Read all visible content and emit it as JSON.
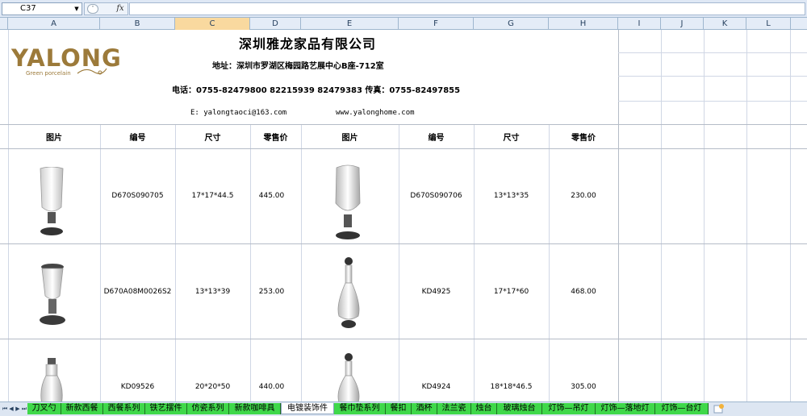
{
  "formula_bar": {
    "cell_ref": "C37",
    "fx_label": "fx"
  },
  "columns": [
    "A",
    "B",
    "C",
    "D",
    "E",
    "F",
    "G",
    "H",
    "I",
    "J",
    "K",
    "L"
  ],
  "selected_column": "C",
  "header": {
    "company": "深圳雅龙家品有限公司",
    "address": "地址：深圳市罗湖区梅园路艺展中心B座-712室",
    "phone": "电话：0755-82479800 82215939 82479383 传真：0755-82497855",
    "email": "E: yalongtaoci@163.com",
    "website": "www.yalonghome.com"
  },
  "logo": {
    "text": "YALONG",
    "subtitle": "Green porcelain",
    "color": "#9c7a3a"
  },
  "table_headers": [
    "图片",
    "编号",
    "尺寸",
    "零售价",
    "图片",
    "编号",
    "尺寸",
    "零售价"
  ],
  "rows": [
    {
      "left": {
        "code": "D670S090705",
        "size": "17*17*44.5",
        "price": "445.00"
      },
      "right": {
        "code": "D670S090706",
        "size": "13*13*35",
        "price": "230.00"
      }
    },
    {
      "left": {
        "code": "D670A08M0026S2",
        "size": "13*13*39",
        "price": "253.00"
      },
      "right": {
        "code": "KD4925",
        "size": "17*17*60",
        "price": "468.00"
      }
    },
    {
      "left": {
        "code": "KD09526",
        "size": "20*20*50",
        "price": "440.00"
      },
      "right": {
        "code": "KD4924",
        "size": "18*18*46.5",
        "price": "305.00"
      }
    }
  ],
  "sheet_tabs": [
    "刀叉勺",
    "新款西餐",
    "西餐系列",
    "铁艺摆件",
    "仿瓷系列",
    "新款咖啡具",
    "电镀装饰件",
    "餐巾垫系列",
    "餐扣",
    "酒杯",
    "法兰瓷",
    "烛台",
    "玻璃烛台",
    "灯饰—吊灯",
    "灯饰—落地灯",
    "灯饰—台灯"
  ],
  "active_tab": "电镀装饰件",
  "colors": {
    "tab_green": "#3fd84a",
    "selected_col": "#f9d99f",
    "grid": "#d0d7e5"
  }
}
